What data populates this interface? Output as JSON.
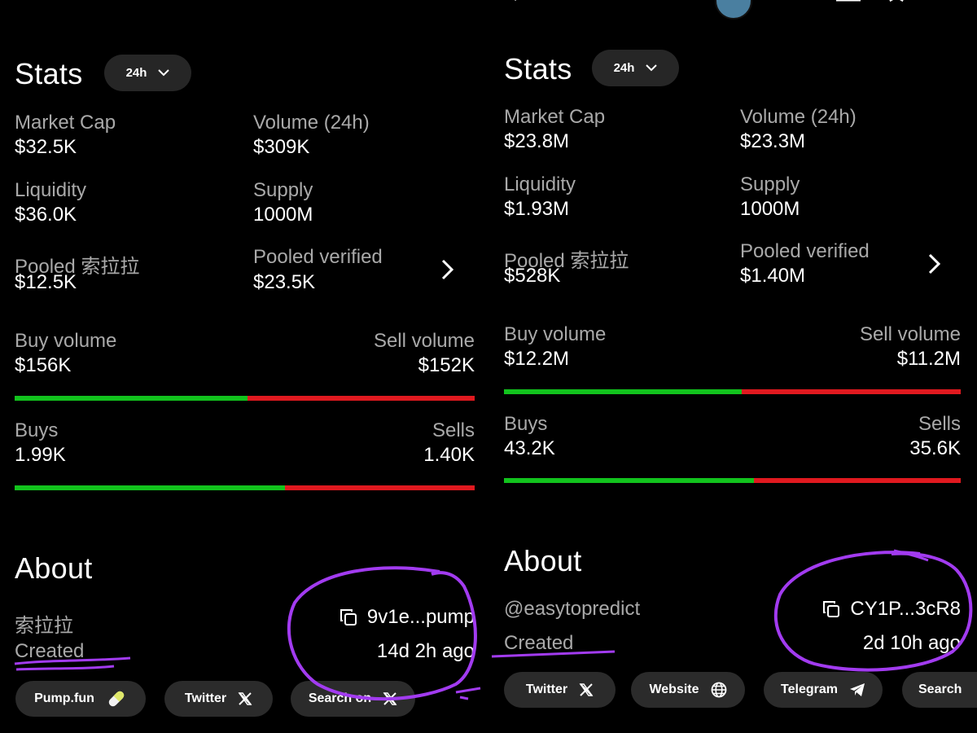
{
  "left": {
    "stats_title": "Stats",
    "timeframe": "24h",
    "market_cap": {
      "label": "Market Cap",
      "value": "$32.5K"
    },
    "volume": {
      "label": "Volume (24h)",
      "value": "$309K"
    },
    "liquidity": {
      "label": "Liquidity",
      "value": "$36.0K"
    },
    "supply": {
      "label": "Supply",
      "value": "1000M"
    },
    "pooled_token": {
      "label": "Pooled 索拉拉",
      "value": "$12.5K"
    },
    "pooled_verified": {
      "label": "Pooled verified",
      "value": "$23.5K"
    },
    "buy_volume": {
      "label": "Buy volume",
      "value": "$156K"
    },
    "sell_volume": {
      "label": "Sell volume",
      "value": "$152K"
    },
    "volume_buy_fraction": 0.506,
    "buys": {
      "label": "Buys",
      "value": "1.99K"
    },
    "sells": {
      "label": "Sells",
      "value": "1.40K"
    },
    "count_buy_fraction": 0.587,
    "about_title": "About",
    "token_name": "索拉拉",
    "address": "9v1e...pump",
    "created_label": "Created",
    "created_value": "14d 2h ago",
    "links": [
      {
        "label": "Pump.fun",
        "icon": "pill-icon"
      },
      {
        "label": "Twitter",
        "icon": "x-logo-icon"
      },
      {
        "label": "Search on",
        "icon": "x-logo-icon"
      }
    ]
  },
  "right": {
    "stats_title": "Stats",
    "timeframe": "24h",
    "market_cap": {
      "label": "Market Cap",
      "value": "$23.8M"
    },
    "volume": {
      "label": "Volume (24h)",
      "value": "$23.3M"
    },
    "liquidity": {
      "label": "Liquidity",
      "value": "$1.93M"
    },
    "supply": {
      "label": "Supply",
      "value": "1000M"
    },
    "pooled_token": {
      "label": "Pooled 索拉拉",
      "value": "$528K"
    },
    "pooled_verified": {
      "label": "Pooled verified",
      "value": "$1.40M"
    },
    "buy_volume": {
      "label": "Buy volume",
      "value": "$12.2M"
    },
    "sell_volume": {
      "label": "Sell volume",
      "value": "$11.2M"
    },
    "volume_buy_fraction": 0.521,
    "buys": {
      "label": "Buys",
      "value": "43.2K"
    },
    "sells": {
      "label": "Sells",
      "value": "35.6K"
    },
    "count_buy_fraction": 0.548,
    "about_title": "About",
    "handle": "@easytopredict",
    "address": "CY1P...3cR8",
    "created_label": "Created",
    "created_value": "2d 10h ago",
    "links": [
      {
        "label": "Twitter",
        "icon": "x-logo-icon"
      },
      {
        "label": "Website",
        "icon": "globe-icon"
      },
      {
        "label": "Telegram",
        "icon": "telegram-icon"
      },
      {
        "label": "Search",
        "icon": ""
      }
    ]
  },
  "colors": {
    "background": "#000000",
    "buy_green": "#12c31d",
    "sell_red": "#e0191f",
    "annotation_purple": "#a23bf0",
    "muted_text": "#a9a9a9",
    "button_bg": "#262626"
  }
}
